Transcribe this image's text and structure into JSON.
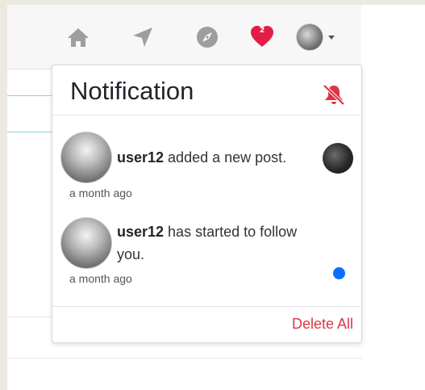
{
  "navbar": {
    "icons": [
      "home-icon",
      "send-icon",
      "explore-icon",
      "heart-icon",
      "avatar"
    ],
    "notification_count": "2",
    "heart_color": "#e11d48",
    "icon_color": "#9e9e9e"
  },
  "notification_panel": {
    "title": "Notification",
    "mute_icon_color": "#dc3545",
    "items": [
      {
        "username": "user12",
        "message": " added a new post.",
        "time": "a month ago",
        "has_post_thumbnail": true,
        "unread": false
      },
      {
        "username": "user12",
        "message": " has started to follow you.",
        "time": "a month ago",
        "has_post_thumbnail": false,
        "unread": true
      }
    ],
    "delete_all_label": "Delete All",
    "delete_color": "#dc3545",
    "unread_dot_color": "#0d6efd"
  }
}
